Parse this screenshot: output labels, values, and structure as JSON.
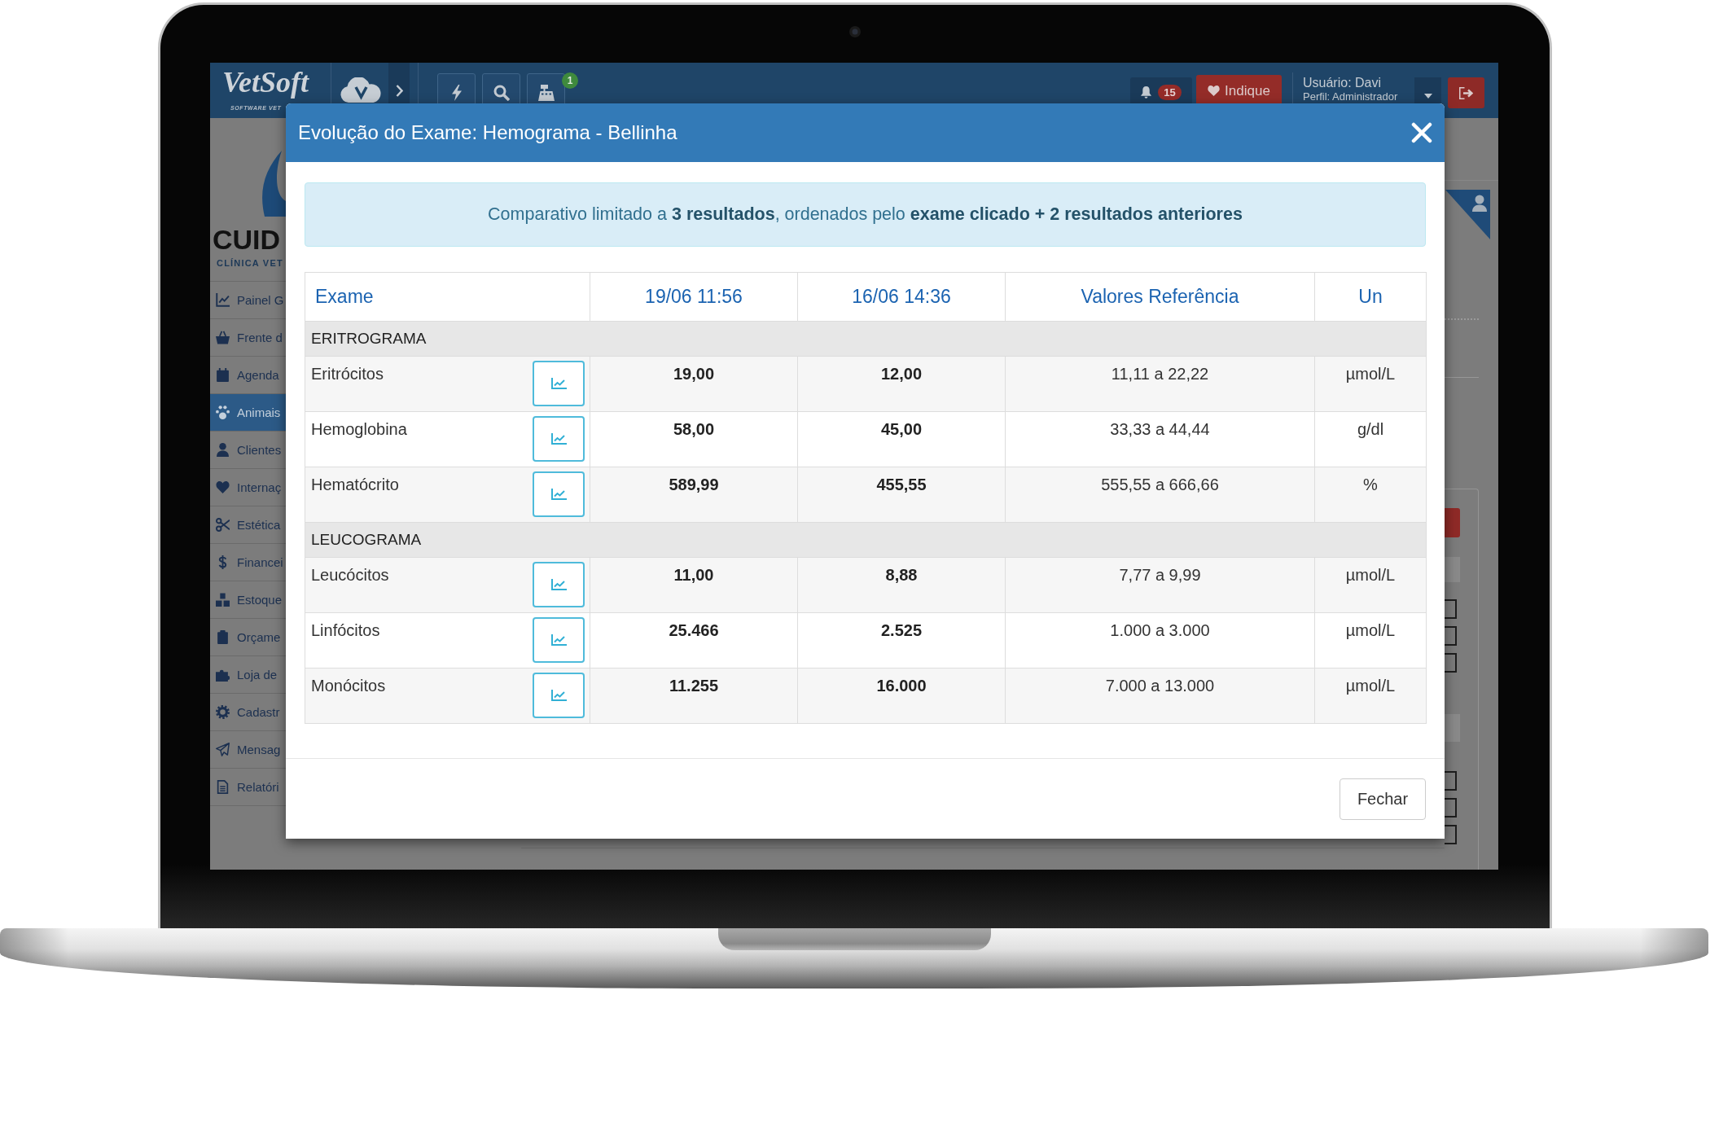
{
  "top_bar": {
    "logo": "VetSoft",
    "logo_tagline": "SOFTWARE VET",
    "register_badge": "1",
    "notification_count": "15",
    "recommend_button": "Indique",
    "user": "Usuário: Davi",
    "profile": "Perfil: Administrador"
  },
  "sidebar": {
    "clinic_name": "CUID",
    "clinic_subtitle": "CLÍNICA VET",
    "items": [
      {
        "label": "Painel G",
        "selected": false
      },
      {
        "label": "Frente d",
        "selected": false
      },
      {
        "label": "Agenda",
        "selected": false
      },
      {
        "label": "Animais",
        "selected": true
      },
      {
        "label": "Clientes",
        "selected": false
      },
      {
        "label": "Internaç",
        "selected": false
      },
      {
        "label": "Estética",
        "selected": false
      },
      {
        "label": "Financei",
        "selected": false
      },
      {
        "label": "Estoque",
        "selected": false
      },
      {
        "label": "Orçame",
        "selected": false
      },
      {
        "label": "Loja de",
        "selected": false
      },
      {
        "label": "Cadastr",
        "selected": false
      },
      {
        "label": "Mensag",
        "selected": false
      },
      {
        "label": "Relatóri",
        "selected": false
      }
    ]
  },
  "modal": {
    "title": "Evolução do Exame: Hemograma - Bellinha",
    "notice": "Comparativo limitado a **3 resultados**, ordenados pelo **exame clicado + 2 resultados anteriores**",
    "table": {
      "columns": [
        "Exame",
        "19/06 11:56",
        "16/06 14:36",
        "Valores Referência",
        "Un"
      ],
      "groups": [
        {
          "name": "ERITROGRAMA",
          "rows": [
            {
              "exam": "Eritrócitos",
              "results": [
                "19,00",
                "12,00"
              ],
              "reference": "11,11 a 22,22",
              "unit": "µmol/L"
            },
            {
              "exam": "Hemoglobina",
              "results": [
                "58,00",
                "45,00"
              ],
              "reference": "33,33 a 44,44",
              "unit": "g/dl"
            },
            {
              "exam": "Hematócrito",
              "results": [
                "589,99",
                "455,55"
              ],
              "reference": "555,55 a 666,66",
              "unit": "%"
            }
          ]
        },
        {
          "name": "LEUCOGRAMA",
          "rows": [
            {
              "exam": "Leucócitos",
              "results": [
                "11,00",
                "8,88"
              ],
              "reference": "7,77 a 9,99",
              "unit": "µmol/L"
            },
            {
              "exam": "Linfócitos",
              "results": [
                "25.466",
                "2.525"
              ],
              "reference": "1.000 a 3.000",
              "unit": "µmol/L"
            },
            {
              "exam": "Monócitos",
              "results": [
                "11.255",
                "16.000"
              ],
              "reference": "7.000 a 13.000",
              "unit": "µmol/L"
            }
          ]
        }
      ]
    },
    "buttons": [
      "Fechar"
    ]
  }
}
